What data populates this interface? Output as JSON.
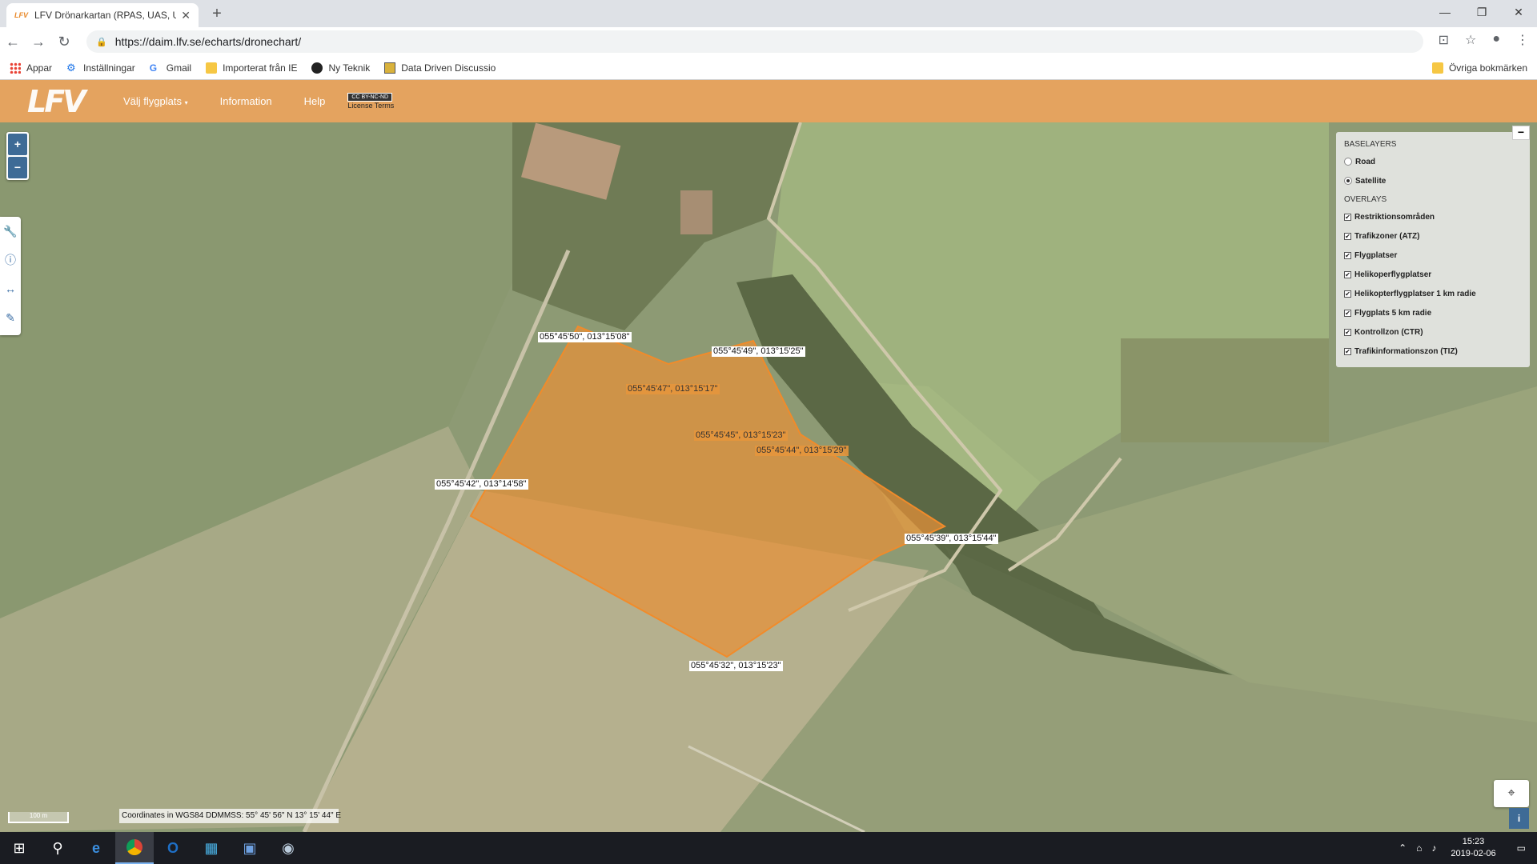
{
  "browser": {
    "tab_title": "LFV Drönarkartan (RPAS, UAS, UA",
    "tab_favicon": "lfv-favicon",
    "url": "https://daim.lfv.se/echarts/dronechart/",
    "bookmarks": [
      {
        "label": "Appar",
        "icon": "apps-grid-icon"
      },
      {
        "label": "Inställningar",
        "icon": "gear-icon"
      },
      {
        "label": "Gmail",
        "icon": "google-icon"
      },
      {
        "label": "Importerat från IE",
        "icon": "folder-icon"
      },
      {
        "label": "Ny Teknik",
        "icon": "nyteknik-icon"
      },
      {
        "label": "Data Driven Discussio",
        "icon": "envelope-icon"
      }
    ],
    "other_bookmarks": "Övriga bokmärken"
  },
  "header": {
    "logo": "LFV",
    "nav": [
      "Välj flygplats",
      "Information",
      "Help"
    ],
    "license_badge": "CC BY-NC-ND",
    "license_label": "License Terms"
  },
  "layers": {
    "baselayers_title": "BASELAYERS",
    "baselayers": [
      {
        "label": "Road",
        "selected": false
      },
      {
        "label": "Satellite",
        "selected": true
      }
    ],
    "overlays_title": "OVERLAYS",
    "overlays": [
      {
        "label": "Restriktionsområden",
        "checked": true
      },
      {
        "label": "Trafikzoner (ATZ)",
        "checked": true
      },
      {
        "label": "Flygplatser",
        "checked": true
      },
      {
        "label": "Helikoperflygplatser",
        "checked": true
      },
      {
        "label": "Helikopterflygplatser 1 km radie",
        "checked": true
      },
      {
        "label": "Flygplats 5 km radie",
        "checked": true
      },
      {
        "label": "Kontrollzon (CTR)",
        "checked": true
      },
      {
        "label": "Trafikinformationszon (TIZ)",
        "checked": true
      }
    ]
  },
  "polygon_labels": [
    "055°45'50\", 013°15'08\"",
    "055°45'49\", 013°15'25\"",
    "055°45'47\", 013°15'17\"",
    "055°45'45\", 013°15'23\"",
    "055°45'44\", 013°15'29\"",
    "055°45'42\", 013°14'58\"",
    "055°45'39\", 013°15'44\"",
    "055°45'32\", 013°15'23\""
  ],
  "map_footer": {
    "scale": "100 m",
    "coordinates": "Coordinates in WGS84 DDMMSS: 55° 45' 56\" N 13° 15' 44\" E"
  },
  "taskbar": {
    "time": "15:23",
    "date": "2019-02-06"
  }
}
